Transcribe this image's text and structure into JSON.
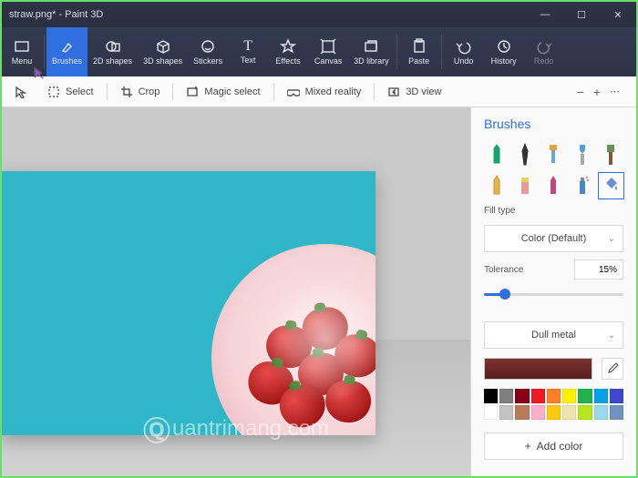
{
  "window": {
    "title": "straw.png* - Paint 3D",
    "controls": {
      "min": "—",
      "max": "☐",
      "close": "✕"
    }
  },
  "ribbon": {
    "menu": "Menu",
    "brushes": "Brushes",
    "shapes2d": "2D shapes",
    "shapes3d": "3D shapes",
    "stickers": "Stickers",
    "text": "Text",
    "effects": "Effects",
    "canvas": "Canvas",
    "library3d": "3D library",
    "paste": "Paste",
    "undo": "Undo",
    "history": "History",
    "redo": "Redo"
  },
  "subbar": {
    "select": "Select",
    "crop": "Crop",
    "magic": "Magic select",
    "mixed": "Mixed reality",
    "view3d": "3D view"
  },
  "side": {
    "title": "Brushes",
    "fill_type_label": "Fill type",
    "fill_type_value": "Color (Default)",
    "tolerance_label": "Tolerance",
    "tolerance_value": "15%",
    "material_value": "Dull metal",
    "current_color": "#5a2322",
    "palette_row1": [
      "#000000",
      "#7f7f7f",
      "#880015",
      "#ed1c24",
      "#ff7f27",
      "#fff200",
      "#22b14c",
      "#00a2e8",
      "#3f48cc"
    ],
    "palette_row2": [
      "#ffffff",
      "#c3c3c3",
      "#b97a57",
      "#ffaec9",
      "#ffc90e",
      "#efe4b0",
      "#b5e61d",
      "#99d9ea",
      "#7092be"
    ],
    "add_color": "Add color"
  },
  "annotation": {
    "arrow_target": "Menu"
  }
}
